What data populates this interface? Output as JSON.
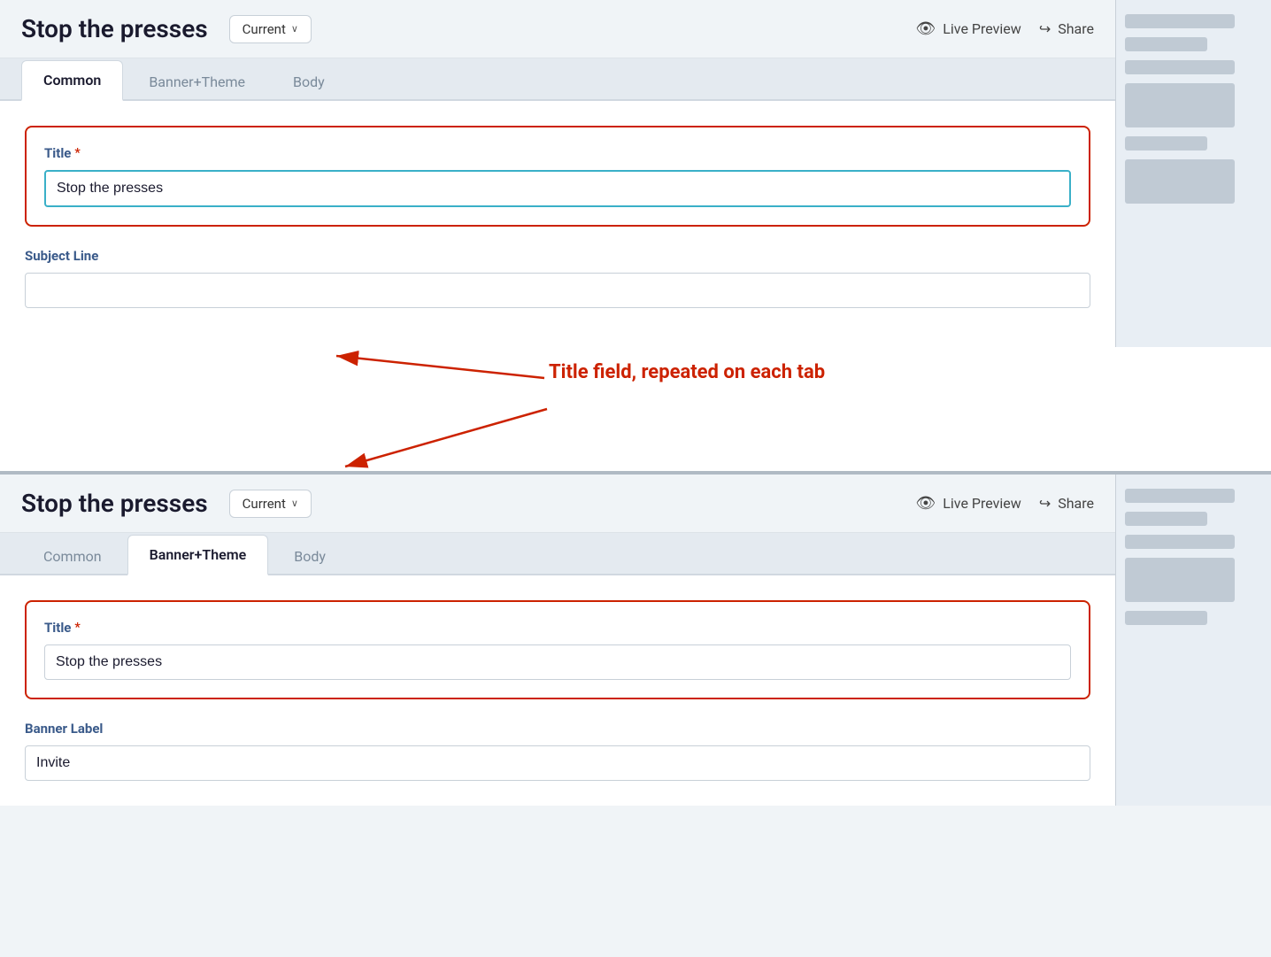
{
  "top_panel": {
    "title": "Stop the presses",
    "version_label": "Current",
    "live_preview_label": "Live Preview",
    "share_label": "Share",
    "tabs": [
      {
        "id": "common",
        "label": "Common",
        "active": true
      },
      {
        "id": "banner-theme",
        "label": "Banner+Theme",
        "active": false
      },
      {
        "id": "body",
        "label": "Body",
        "active": false
      }
    ],
    "title_field": {
      "label": "Title",
      "required": true,
      "value": "Stop the presses",
      "placeholder": ""
    },
    "subject_field": {
      "label": "Subject Line",
      "value": "",
      "placeholder": ""
    }
  },
  "annotation": {
    "text": "Title field, repeated on each tab"
  },
  "bottom_panel": {
    "title": "Stop the presses",
    "version_label": "Current",
    "live_preview_label": "Live Preview",
    "share_label": "Share",
    "tabs": [
      {
        "id": "common",
        "label": "Common",
        "active": false
      },
      {
        "id": "banner-theme",
        "label": "Banner+Theme",
        "active": true
      },
      {
        "id": "body",
        "label": "Body",
        "active": false
      }
    ],
    "title_field": {
      "label": "Title",
      "required": true,
      "value": "Stop the presses",
      "placeholder": ""
    },
    "banner_label_field": {
      "label": "Banner Label",
      "value": "Invite",
      "placeholder": ""
    }
  },
  "icons": {
    "eye": "👁",
    "share": "↪",
    "chevron_down": "∨"
  }
}
